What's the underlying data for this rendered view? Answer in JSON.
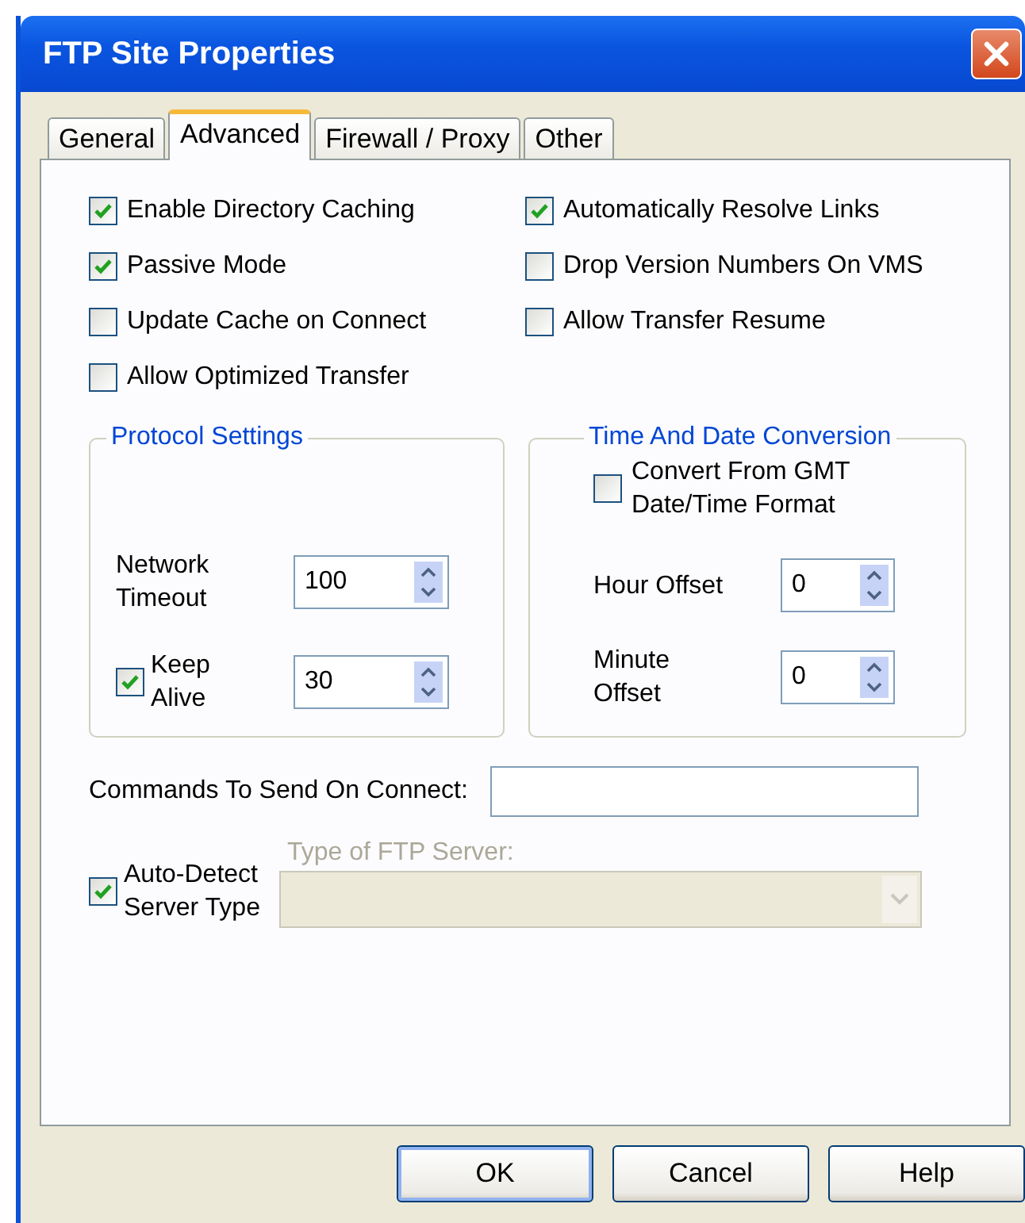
{
  "window": {
    "title": "FTP Site Properties"
  },
  "tabs": [
    {
      "label": "General",
      "selected": false
    },
    {
      "label": "Advanced",
      "selected": true
    },
    {
      "label": "Firewall / Proxy",
      "selected": false
    },
    {
      "label": "Other",
      "selected": false
    }
  ],
  "options": [
    {
      "label": "Enable Directory Caching",
      "checked": true
    },
    {
      "label": "Automatically Resolve Links",
      "checked": true
    },
    {
      "label": "Passive Mode",
      "checked": true
    },
    {
      "label": "Drop Version Numbers On VMS",
      "checked": false
    },
    {
      "label": "Update Cache on Connect",
      "checked": false
    },
    {
      "label": "Allow Transfer Resume",
      "checked": false
    },
    {
      "label": "Allow Optimized Transfer",
      "checked": false
    }
  ],
  "protocol_settings": {
    "title": "Protocol Settings",
    "fields": [
      {
        "kind": "spinner",
        "label": "Network\nTimeout",
        "value": "100"
      },
      {
        "kind": "checkspinner",
        "label": "Keep\nAlive",
        "value": "30",
        "checked": true
      }
    ]
  },
  "time_conversion": {
    "title": "Time And Date Conversion",
    "convert": {
      "label": "Convert From GMT\nDate/Time Format",
      "checked": false
    },
    "fields": [
      {
        "label": "Hour Offset",
        "value": "0"
      },
      {
        "label": "Minute\nOffset",
        "value": "0"
      }
    ]
  },
  "commands": {
    "label": "Commands To Send On Connect:"
  },
  "server_type": {
    "auto_detect": {
      "label": "Auto-Detect\nServer Type",
      "checked": true
    },
    "combo_label": "Type of FTP Server:",
    "disabled": true
  },
  "buttons": [
    {
      "label": "OK",
      "default": true
    },
    {
      "label": "Cancel",
      "default": false
    },
    {
      "label": "Help",
      "default": false
    }
  ]
}
